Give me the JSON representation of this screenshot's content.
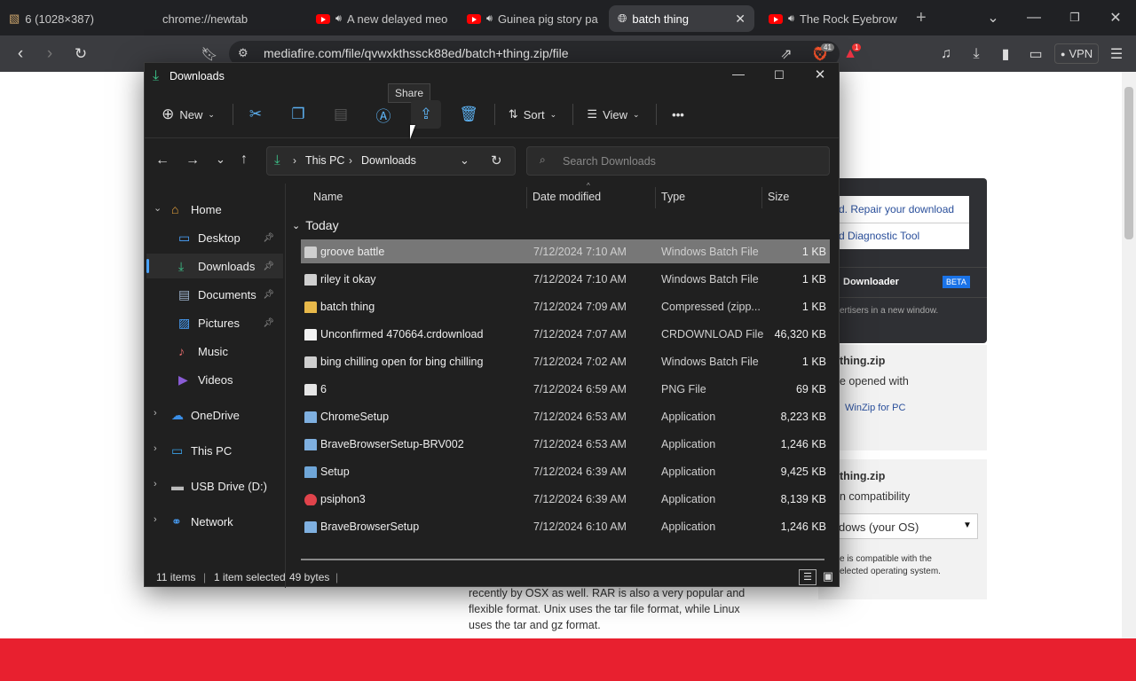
{
  "browser": {
    "tabs": [
      {
        "label": "6 (1028×387)",
        "icon": "image-icon"
      },
      {
        "label": "chrome://newtab",
        "icon": "none"
      },
      {
        "label": "A new delayed meo",
        "icon": "youtube-icon",
        "audio": true
      },
      {
        "label": "Guinea pig story pa",
        "icon": "youtube-icon",
        "audio": true
      },
      {
        "label": "batch thing",
        "icon": "globe-icon",
        "active": true
      },
      {
        "label": "The Rock Eyebrow",
        "icon": "youtube-icon",
        "audio": true
      }
    ],
    "new_tab": "+",
    "url": "mediafire.com/file/qvwxkthssck88ed/batch+thing.zip/file",
    "vpn": "VPN",
    "brave_badge": "41",
    "rewards_badge": "1"
  },
  "page": {
    "repair_link": "d. Repair your download",
    "diagnostic_link": "d Diagnostic Tool",
    "downloader": "Downloader",
    "beta": "BETA",
    "advertisers": "ertisers in a new window.",
    "file1_title": "thing.zip",
    "file1_line": "e opened with",
    "winzip": "WinZip for PC",
    "file2_title": "thing.zip",
    "file2_line": "n compatibility",
    "os_select": "dows (your OS)",
    "compat_note1": "e is compatible with the",
    "compat_note2": "elected operating system.",
    "para": [
      "recently by OSX as well. RAR is also a very popular and",
      "flexible format. Unix uses the tar file format, while Linux",
      "uses the tar and gz format."
    ]
  },
  "explorer": {
    "title": "Downloads",
    "tooltip": "Share",
    "toolbar": {
      "new": "New",
      "sort": "Sort",
      "view": "View",
      "more": "•••"
    },
    "breadcrumb": [
      "This PC",
      "Downloads"
    ],
    "search_placeholder": "Search Downloads",
    "columns": {
      "name": "Name",
      "date": "Date modified",
      "type": "Type",
      "size": "Size"
    },
    "group": "Today",
    "sidebar": [
      {
        "label": "Home",
        "icon": "home-icon",
        "expander": true,
        "expanded": true,
        "indent": 0
      },
      {
        "label": "Desktop",
        "icon": "desktop-icon",
        "pinned": true,
        "indent": 1
      },
      {
        "label": "Downloads",
        "icon": "download-icon",
        "pinned": true,
        "indent": 1,
        "selected": true
      },
      {
        "label": "Documents",
        "icon": "documents-icon",
        "pinned": true,
        "indent": 1
      },
      {
        "label": "Pictures",
        "icon": "pictures-icon",
        "pinned": true,
        "indent": 1
      },
      {
        "label": "Music",
        "icon": "music-icon",
        "indent": 1
      },
      {
        "label": "Videos",
        "icon": "videos-icon",
        "indent": 1
      },
      {
        "label": "OneDrive",
        "icon": "cloud-icon",
        "expander": true,
        "indent": 0
      },
      {
        "label": "This PC",
        "icon": "pc-icon",
        "expander": true,
        "indent": 0
      },
      {
        "label": "USB Drive (D:)",
        "icon": "usb-drive-icon",
        "expander": true,
        "indent": 0
      },
      {
        "label": "Network",
        "icon": "network-icon",
        "expander": true,
        "indent": 0
      }
    ],
    "files": [
      {
        "name": "groove battle",
        "date": "7/12/2024 7:10 AM",
        "type": "Windows Batch File",
        "size": "1 KB",
        "icon": "batch-file-icon",
        "selected": true
      },
      {
        "name": "riley it okay",
        "date": "7/12/2024 7:10 AM",
        "type": "Windows Batch File",
        "size": "1 KB",
        "icon": "batch-file-icon"
      },
      {
        "name": "batch thing",
        "date": "7/12/2024 7:09 AM",
        "type": "Compressed (zipp...",
        "size": "1 KB",
        "icon": "zip-folder-icon"
      },
      {
        "name": "Unconfirmed 470664.crdownload",
        "date": "7/12/2024 7:07 AM",
        "type": "CRDOWNLOAD File",
        "size": "46,320 KB",
        "icon": "blank-file-icon"
      },
      {
        "name": "bing chilling open for bing chilling",
        "date": "7/12/2024 7:02 AM",
        "type": "Windows Batch File",
        "size": "1 KB",
        "icon": "batch-file-icon"
      },
      {
        "name": "6",
        "date": "7/12/2024 6:59 AM",
        "type": "PNG File",
        "size": "69 KB",
        "icon": "png-file-icon"
      },
      {
        "name": "ChromeSetup",
        "date": "7/12/2024 6:53 AM",
        "type": "Application",
        "size": "8,223 KB",
        "icon": "installer-icon"
      },
      {
        "name": "BraveBrowserSetup-BRV002",
        "date": "7/12/2024 6:53 AM",
        "type": "Application",
        "size": "1,246 KB",
        "icon": "installer-icon"
      },
      {
        "name": "Setup",
        "date": "7/12/2024 6:39 AM",
        "type": "Application",
        "size": "9,425 KB",
        "icon": "setup-icon"
      },
      {
        "name": "psiphon3",
        "date": "7/12/2024 6:39 AM",
        "type": "Application",
        "size": "8,139 KB",
        "icon": "psiphon-icon"
      },
      {
        "name": "BraveBrowserSetup",
        "date": "7/12/2024 6:10 AM",
        "type": "Application",
        "size": "1,246 KB",
        "icon": "installer-icon"
      }
    ],
    "status": {
      "count": "11 items",
      "selected": "1 item selected",
      "bytes": "49 bytes"
    }
  }
}
